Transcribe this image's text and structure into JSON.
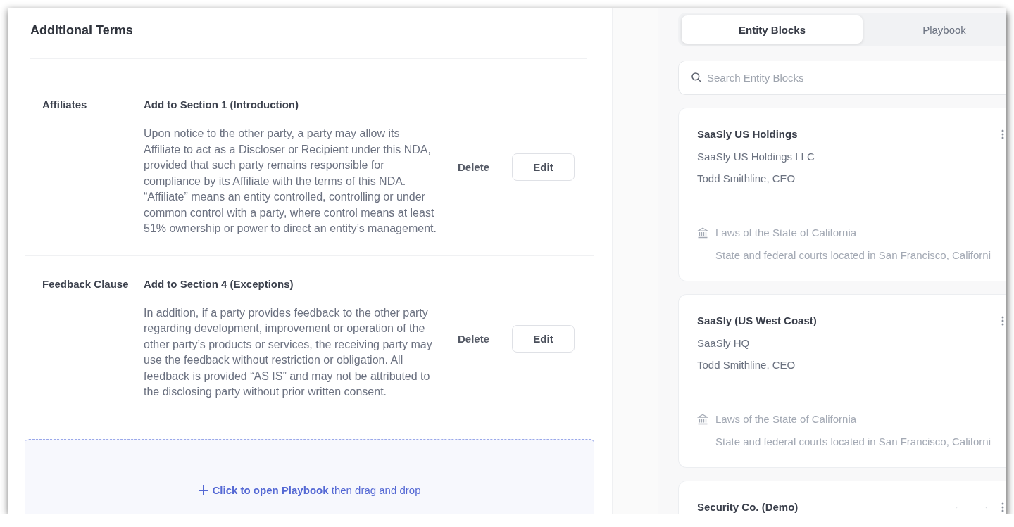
{
  "panel": {
    "title": "Additional Terms"
  },
  "terms": [
    {
      "label": "Affiliates",
      "section": "Add to Section 1 (Introduction)",
      "text": "Upon notice to the other party, a party may allow its Affiliate to act as a Discloser or Recipient under this NDA, provided that such party remains responsible for compliance by its Affiliate with the terms of this NDA. “Affiliate” means an entity controlled, controlling or under common control with a party, where control means at least 51% ownership or power to direct an entity’s management.",
      "delete_label": "Delete",
      "edit_label": "Edit"
    },
    {
      "label": "Feedback Clause",
      "section": "Add to Section 4 (Exceptions)",
      "text": "In addition, if a party provides feedback to the other party regarding development, improvement or operation of the other party’s products or services, the receiving party may use the feedback without restriction or obligation. All feedback is provided “AS IS” and may not be attributed to the disclosing party without prior written consent.",
      "delete_label": "Delete",
      "edit_label": "Edit"
    }
  ],
  "drop_zone": {
    "text": "**Click to open Playbook** then drag and drop"
  },
  "tabs": [
    {
      "label": "Entity Blocks",
      "selected": true
    },
    {
      "label": "Playbook",
      "selected": false
    }
  ],
  "search": {
    "placeholder": "Search Entity Blocks"
  },
  "entities": [
    {
      "name": "SaaSly US Holdings",
      "legal_name": "SaaSly US Holdings LLC",
      "signatory": "Todd Smithline, CEO",
      "governing_law": "Laws of the State of California",
      "jurisdiction": "State and federal courts located in San Francisco, Californi"
    },
    {
      "name": "SaaSly (US West Coast)",
      "legal_name": "SaaSly HQ",
      "signatory": "Todd Smithline, CEO",
      "governing_law": "Laws of the State of California",
      "jurisdiction": "State and federal courts located in San Francisco, Californi"
    },
    {
      "name": "Security Co. (Demo)",
      "has_chip": true
    }
  ]
}
